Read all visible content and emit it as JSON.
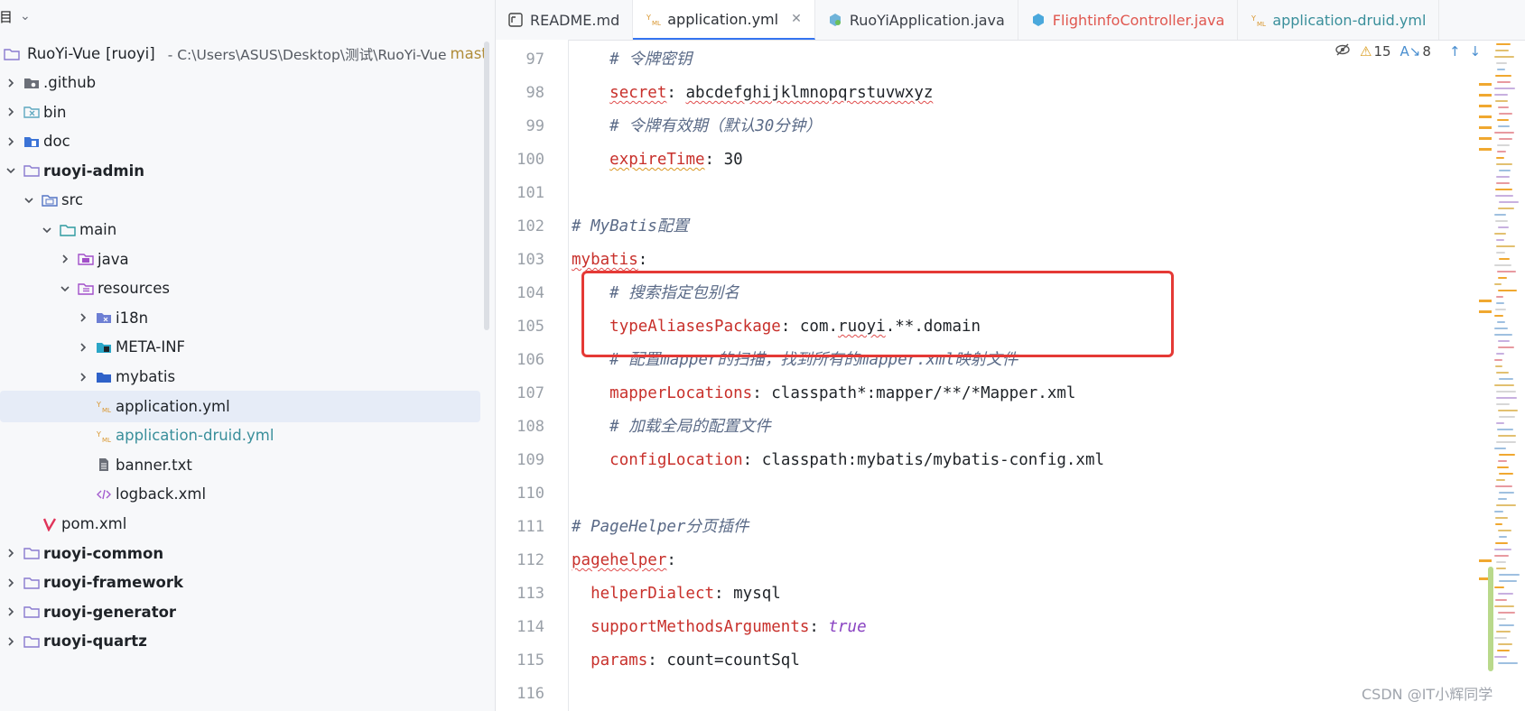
{
  "project_panel": {
    "title": "项目",
    "root": {
      "name": "RuoYi-Vue",
      "module": "[ruoyi]",
      "path": "- C:\\Users\\ASUS\\Desktop\\测试\\RuoYi-Vue",
      "branch": "mast"
    },
    "items": [
      {
        "label": ".github",
        "depth": 0,
        "expandable": true,
        "expanded": false,
        "style": "normal",
        "icon": "folder-git-icon"
      },
      {
        "label": "bin",
        "depth": 0,
        "expandable": true,
        "expanded": false,
        "style": "normal",
        "icon": "folder-excluded-icon"
      },
      {
        "label": "doc",
        "depth": 0,
        "expandable": true,
        "expanded": false,
        "style": "normal",
        "icon": "folder-doc-icon"
      },
      {
        "label": "ruoyi-admin",
        "depth": 0,
        "expandable": true,
        "expanded": true,
        "style": "bold",
        "icon": "module-folder-icon"
      },
      {
        "label": "src",
        "depth": 1,
        "expandable": true,
        "expanded": true,
        "style": "normal",
        "icon": "source-folder-icon"
      },
      {
        "label": "main",
        "depth": 2,
        "expandable": true,
        "expanded": true,
        "style": "normal",
        "icon": "folder-teal-icon"
      },
      {
        "label": "java",
        "depth": 3,
        "expandable": true,
        "expanded": false,
        "style": "normal",
        "icon": "java-source-folder-icon"
      },
      {
        "label": "resources",
        "depth": 3,
        "expandable": true,
        "expanded": true,
        "style": "normal",
        "icon": "resources-folder-icon"
      },
      {
        "label": "i18n",
        "depth": 4,
        "expandable": true,
        "expanded": false,
        "style": "normal",
        "icon": "i18n-folder-icon"
      },
      {
        "label": "META-INF",
        "depth": 4,
        "expandable": true,
        "expanded": false,
        "style": "normal",
        "icon": "meta-inf-folder-icon"
      },
      {
        "label": "mybatis",
        "depth": 4,
        "expandable": true,
        "expanded": false,
        "style": "normal",
        "icon": "folder-blue-icon"
      },
      {
        "label": "application.yml",
        "depth": 4,
        "expandable": false,
        "expanded": false,
        "style": "selected",
        "icon": "yaml-file-icon"
      },
      {
        "label": "application-druid.yml",
        "depth": 4,
        "expandable": false,
        "expanded": false,
        "style": "teal",
        "icon": "yaml-file-icon"
      },
      {
        "label": "banner.txt",
        "depth": 4,
        "expandable": false,
        "expanded": false,
        "style": "normal",
        "icon": "text-file-icon"
      },
      {
        "label": "logback.xml",
        "depth": 4,
        "expandable": false,
        "expanded": false,
        "style": "normal",
        "icon": "xml-file-icon"
      },
      {
        "label": "pom.xml",
        "depth": 1,
        "expandable": false,
        "expanded": false,
        "style": "normal",
        "icon": "maven-icon"
      },
      {
        "label": "ruoyi-common",
        "depth": 0,
        "expandable": true,
        "expanded": false,
        "style": "bold",
        "icon": "module-folder-icon"
      },
      {
        "label": "ruoyi-framework",
        "depth": 0,
        "expandable": true,
        "expanded": false,
        "style": "bold",
        "icon": "module-folder-icon"
      },
      {
        "label": "ruoyi-generator",
        "depth": 0,
        "expandable": true,
        "expanded": false,
        "style": "bold",
        "icon": "module-folder-icon"
      },
      {
        "label": "ruoyi-quartz",
        "depth": 0,
        "expandable": true,
        "expanded": false,
        "style": "bold",
        "icon": "module-folder-icon"
      }
    ]
  },
  "tabs": [
    {
      "label": "README.md",
      "icon": "markdown-icon",
      "active": false,
      "style": "normal"
    },
    {
      "label": "application.yml",
      "icon": "yaml-file-icon",
      "active": true,
      "style": "normal",
      "closable": true
    },
    {
      "label": "RuoYiApplication.java",
      "icon": "spring-class-icon",
      "active": false,
      "style": "normal"
    },
    {
      "label": "FlightinfoController.java",
      "icon": "class-icon",
      "active": false,
      "style": "red"
    },
    {
      "label": "application-druid.yml",
      "icon": "yaml-file-icon",
      "active": false,
      "style": "teal"
    }
  ],
  "inspections": {
    "warnings": "15",
    "weak_warnings": "8"
  },
  "editor_lines": [
    {
      "n": "97",
      "parts": [
        {
          "t": "    # 令牌密钥",
          "c": "cm"
        }
      ]
    },
    {
      "n": "98",
      "parts": [
        {
          "t": "    ",
          "c": "val"
        },
        {
          "t": "secret",
          "c": "key squig"
        },
        {
          "t": ": ",
          "c": "val"
        },
        {
          "t": "abcdefghijklmnopqrstuvwxyz",
          "c": "val squig"
        }
      ]
    },
    {
      "n": "99",
      "parts": [
        {
          "t": "    # 令牌有效期（默认30分钟）",
          "c": "cm"
        }
      ]
    },
    {
      "n": "100",
      "parts": [
        {
          "t": "    ",
          "c": "val"
        },
        {
          "t": "expireTime",
          "c": "key squigo"
        },
        {
          "t": ": 30",
          "c": "val"
        }
      ]
    },
    {
      "n": "101",
      "parts": []
    },
    {
      "n": "102",
      "parts": [
        {
          "t": "# MyBatis配置",
          "c": "cm"
        }
      ]
    },
    {
      "n": "103",
      "parts": [
        {
          "t": "mybatis",
          "c": "key squig"
        },
        {
          "t": ":",
          "c": "val"
        }
      ]
    },
    {
      "n": "104",
      "parts": [
        {
          "t": "    # 搜索指定包别名",
          "c": "cm"
        }
      ]
    },
    {
      "n": "105",
      "parts": [
        {
          "t": "    ",
          "c": "val"
        },
        {
          "t": "typeAliasesPackage",
          "c": "key"
        },
        {
          "t": ": com.",
          "c": "val"
        },
        {
          "t": "ruoyi",
          "c": "val squig"
        },
        {
          "t": ".**.domain",
          "c": "val"
        }
      ]
    },
    {
      "n": "106",
      "parts": [
        {
          "t": "    # 配置mapper的扫描，找到所有的mapper.xml映射文件",
          "c": "cm"
        }
      ]
    },
    {
      "n": "107",
      "parts": [
        {
          "t": "    ",
          "c": "val"
        },
        {
          "t": "mapperLocations",
          "c": "key"
        },
        {
          "t": ": classpath*:mapper/**/*Mapper.xml",
          "c": "val"
        }
      ]
    },
    {
      "n": "108",
      "parts": [
        {
          "t": "    # 加载全局的配置文件",
          "c": "cm"
        }
      ]
    },
    {
      "n": "109",
      "parts": [
        {
          "t": "    ",
          "c": "val"
        },
        {
          "t": "configLocation",
          "c": "key"
        },
        {
          "t": ": classpath:mybatis/mybatis-config.xml",
          "c": "val"
        }
      ]
    },
    {
      "n": "110",
      "parts": []
    },
    {
      "n": "111",
      "parts": [
        {
          "t": "# PageHelper分页插件",
          "c": "cm"
        }
      ]
    },
    {
      "n": "112",
      "parts": [
        {
          "t": "pagehelper",
          "c": "key squig"
        },
        {
          "t": ":",
          "c": "val"
        }
      ]
    },
    {
      "n": "113",
      "parts": [
        {
          "t": "  ",
          "c": "val"
        },
        {
          "t": "helperDialect",
          "c": "key"
        },
        {
          "t": ": mysql",
          "c": "val"
        }
      ]
    },
    {
      "n": "114",
      "parts": [
        {
          "t": "  ",
          "c": "val"
        },
        {
          "t": "supportMethodsArguments",
          "c": "key"
        },
        {
          "t": ": ",
          "c": "val"
        },
        {
          "t": "true",
          "c": "kw"
        }
      ]
    },
    {
      "n": "115",
      "parts": [
        {
          "t": "  ",
          "c": "val"
        },
        {
          "t": "params",
          "c": "key"
        },
        {
          "t": ": count=countSql",
          "c": "val"
        }
      ]
    },
    {
      "n": "116",
      "parts": []
    }
  ],
  "watermark": "CSDN @IT小辉同学"
}
